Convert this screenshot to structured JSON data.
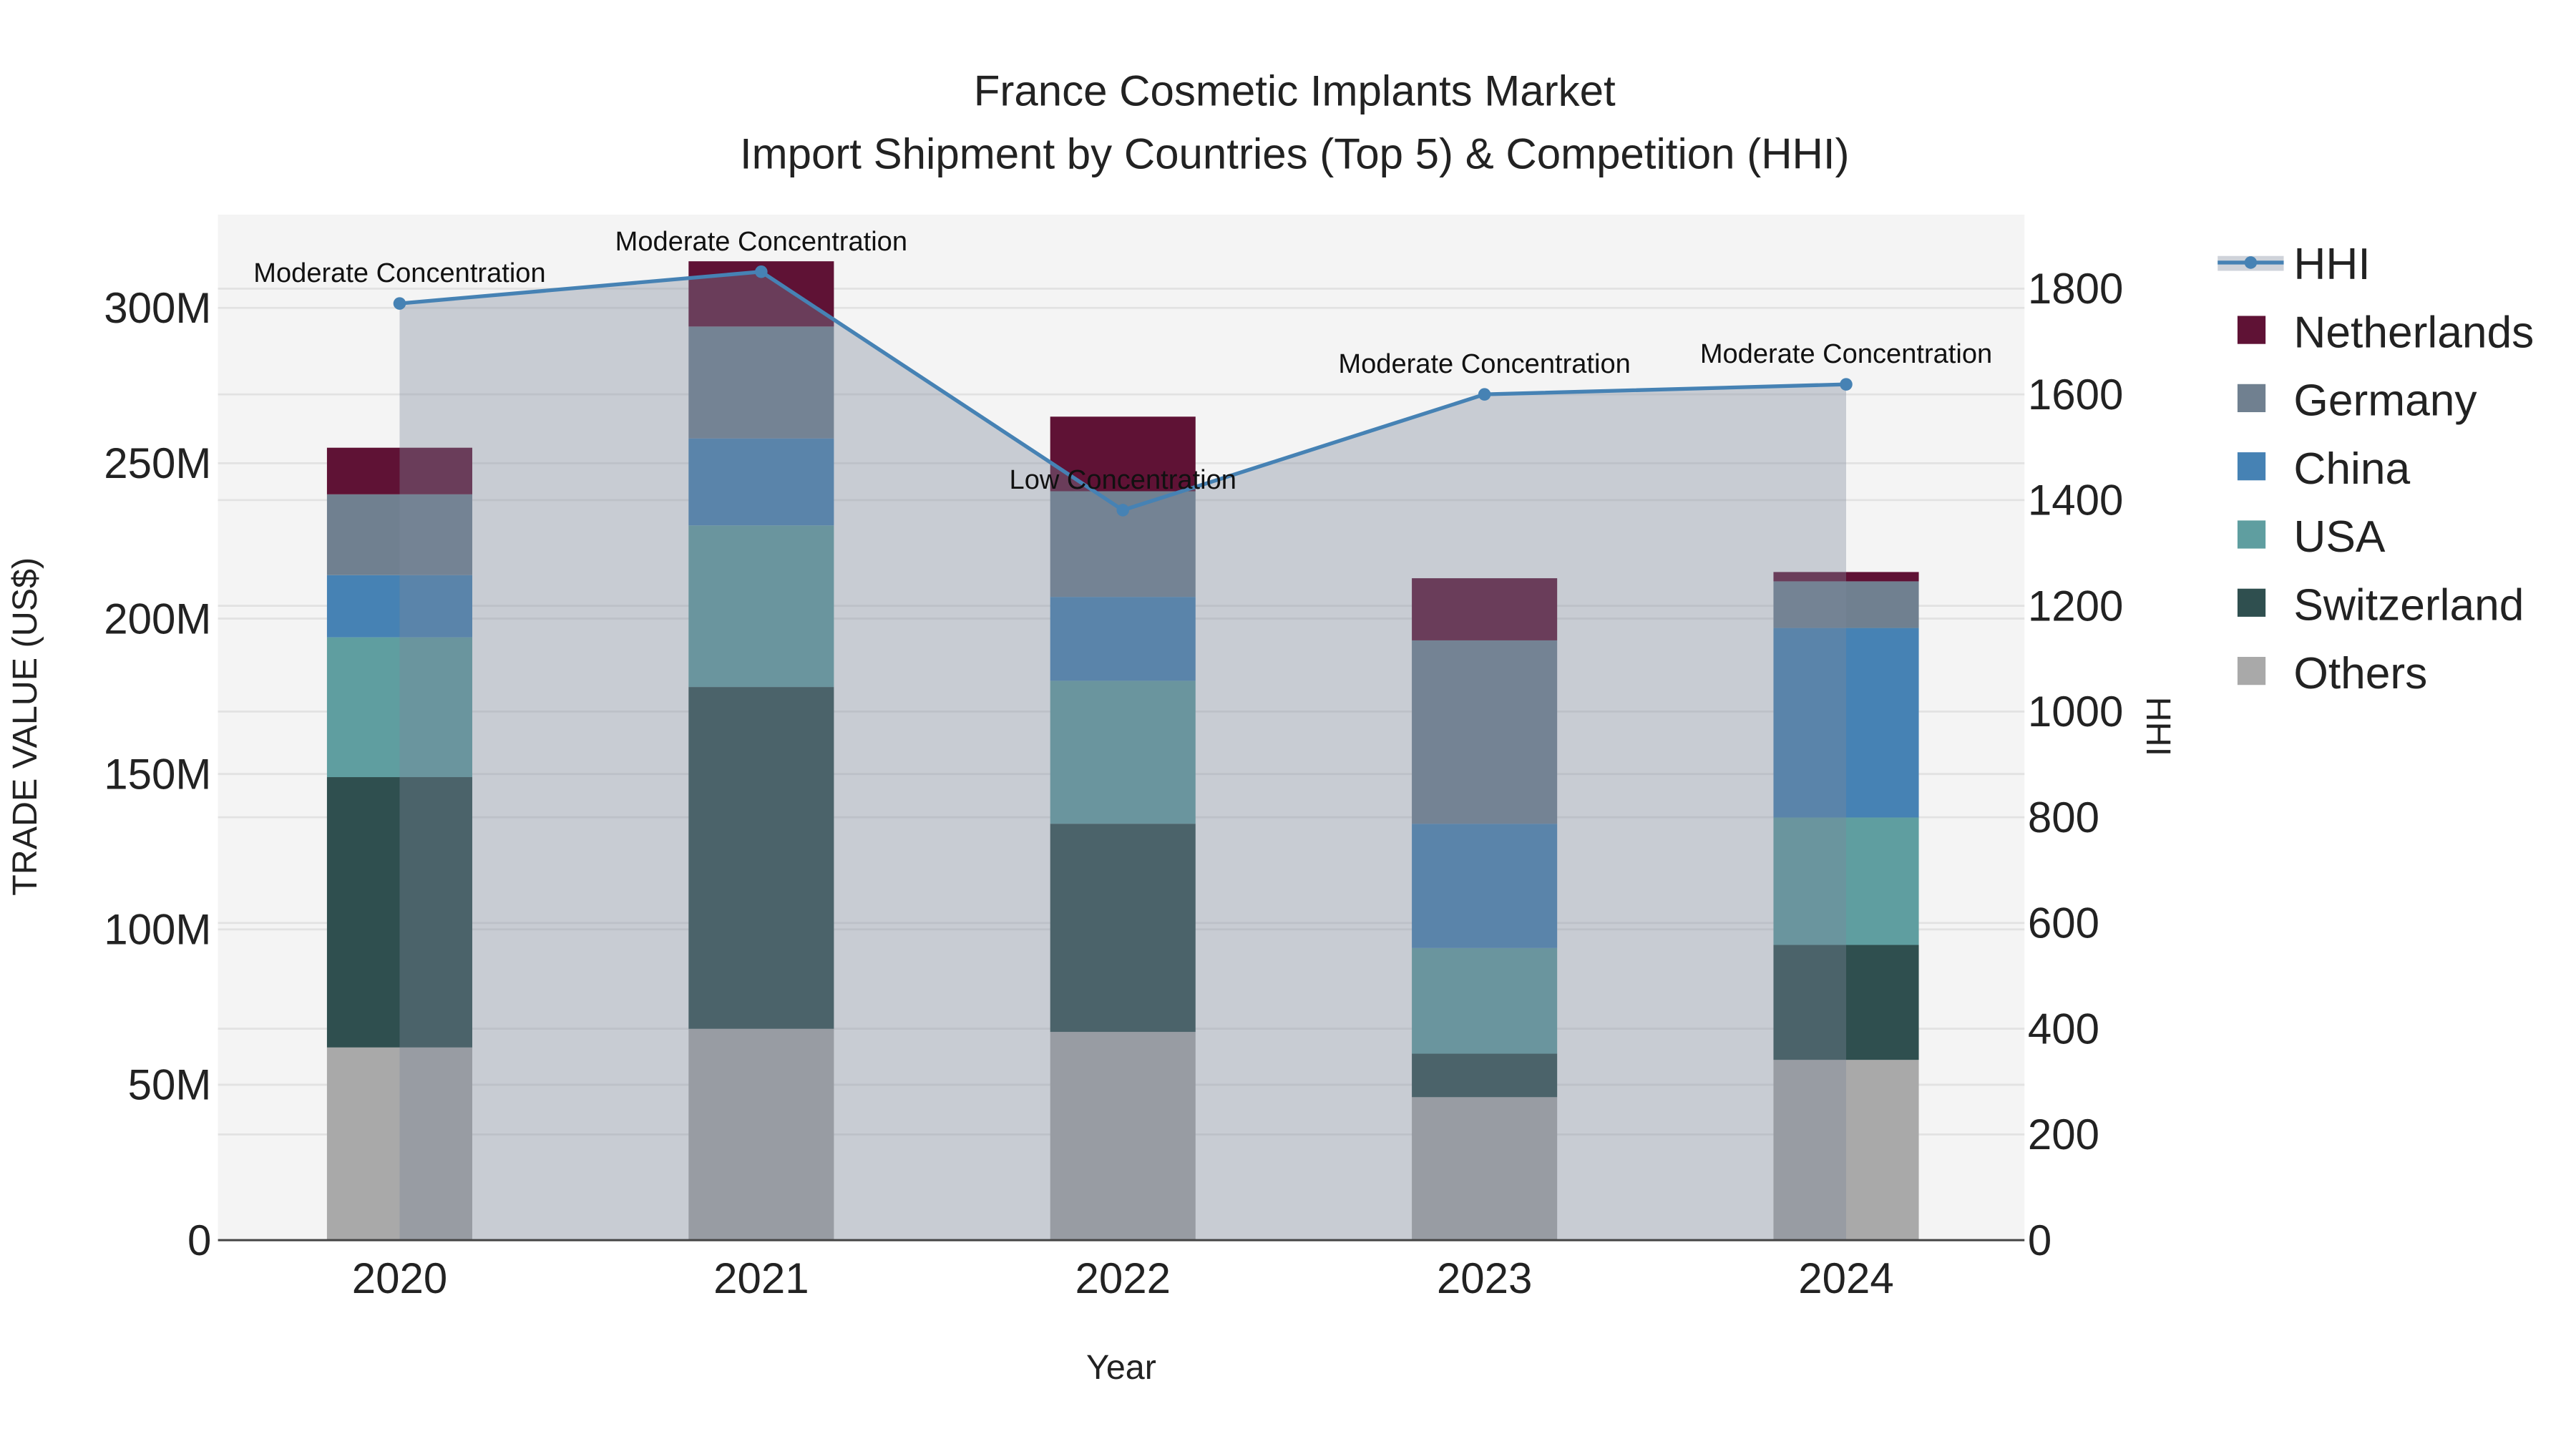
{
  "chart_data": {
    "type": "bar",
    "title": "France Cosmetic Implants Market",
    "subtitle": "Import Shipment by Countries (Top 5) & Competition (HHI)",
    "xlabel": "Year",
    "ylabel": "TRADE VALUE (US$)",
    "y2label": "HHI",
    "categories": [
      "2020",
      "2021",
      "2022",
      "2023",
      "2024"
    ],
    "ylim": [
      0,
      330
    ],
    "yticks": [
      {
        "v": 0,
        "label": "0"
      },
      {
        "v": 50,
        "label": "50M"
      },
      {
        "v": 100,
        "label": "100M"
      },
      {
        "v": 150,
        "label": "150M"
      },
      {
        "v": 200,
        "label": "200M"
      },
      {
        "v": 250,
        "label": "250M"
      },
      {
        "v": 300,
        "label": "300M"
      }
    ],
    "y2lim": [
      0,
      1940
    ],
    "y2ticks": [
      0,
      200,
      400,
      600,
      800,
      1000,
      1200,
      1400,
      1600,
      1800
    ],
    "stacked": true,
    "series": [
      {
        "name": "Others",
        "color": "#a9a9a9",
        "values": [
          62,
          68,
          67,
          46,
          58
        ]
      },
      {
        "name": "Switzerland",
        "color": "#2f4f4f",
        "values": [
          87,
          110,
          67,
          14,
          37
        ]
      },
      {
        "name": "USA",
        "color": "#5f9ea0",
        "values": [
          45,
          52,
          46,
          34,
          41
        ]
      },
      {
        "name": "China",
        "color": "#4682b4",
        "values": [
          20,
          28,
          27,
          40,
          61
        ]
      },
      {
        "name": "Germany",
        "color": "#708090",
        "values": [
          26,
          36,
          34,
          59,
          15
        ]
      },
      {
        "name": "Netherlands",
        "color": "#5f1235",
        "values": [
          15,
          21,
          24,
          20,
          3
        ]
      }
    ],
    "hhi": {
      "name": "HHI",
      "color": "#4682b4",
      "values": [
        1772,
        1832,
        1381,
        1600,
        1619
      ],
      "annotations": [
        "Moderate Concentration",
        "Moderate Concentration",
        "Low Concentration",
        "Moderate Concentration",
        "Moderate Concentration"
      ]
    },
    "legend": {
      "placement": "right",
      "order": [
        "HHI",
        "Netherlands",
        "Germany",
        "China",
        "USA",
        "Switzerland",
        "Others"
      ]
    },
    "grid": true
  }
}
